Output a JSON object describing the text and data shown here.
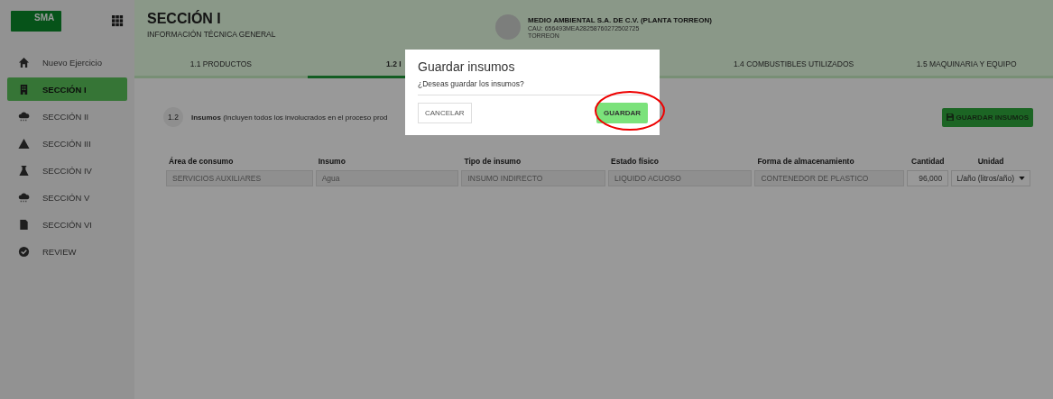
{
  "sidebar": {
    "logo": "SMA",
    "items": [
      {
        "label": "Nuevo Ejercicio",
        "kind": "home",
        "selected": false
      },
      {
        "label": "SECCIÓN I",
        "kind": "building",
        "selected": true
      },
      {
        "label": "SECCIÓN II",
        "kind": "cloud",
        "selected": false
      },
      {
        "label": "SECCIÓN III",
        "kind": "warning",
        "selected": false
      },
      {
        "label": "SECCIÓN IV",
        "kind": "flask",
        "selected": false
      },
      {
        "label": "SECCIÓN V",
        "kind": "cloud",
        "selected": false
      },
      {
        "label": "SECCIÓN VI",
        "kind": "file",
        "selected": false
      },
      {
        "label": "REVIEW",
        "kind": "check",
        "selected": false
      }
    ]
  },
  "header": {
    "title": "SECCIÓN I",
    "subtitle": "INFORMACIÓN TÉCNICA GENERAL",
    "company": "MEDIO AMBIENTAL S.A. DE C.V. (PLANTA TORREON)",
    "cau": "CAU: 656493MEA28258760272502725",
    "city": "TORREON"
  },
  "tabs": [
    {
      "label": "1.1 PRODUCTOS",
      "selected": false
    },
    {
      "label": "1.2 I",
      "selected": true
    },
    {
      "label": "1.4 COMBUSTIBLES UTILIZADOS",
      "selected": false
    },
    {
      "label": "1.5 MAQUINARIA Y EQUIPO",
      "selected": false
    }
  ],
  "section": {
    "number": "1.2",
    "text": "**Insumos** (Incluyen todos los involucrados en el proceso prod",
    "save_button": "GUARDAR INSUMOS"
  },
  "table": {
    "columns": [
      "Área de consumo",
      "Insumo",
      "Tipo de insumo",
      "Estado físico",
      "Forma de almacenamiento",
      "Cantidad",
      "Unidad"
    ],
    "rows": [
      [
        "SERVICIOS AUXILIARES",
        "Agua",
        "INSUMO INDIRECTO",
        "LIQUIDO ACUOSO",
        "CONTENEDOR DE PLASTICO",
        "96,000",
        "L/año (litros/año)"
      ]
    ]
  },
  "dialog": {
    "title": "Guardar insumos",
    "message": "¿Deseas guardar los insumos?",
    "cancel": "CANCELAR",
    "confirm": "GUARDAR"
  }
}
